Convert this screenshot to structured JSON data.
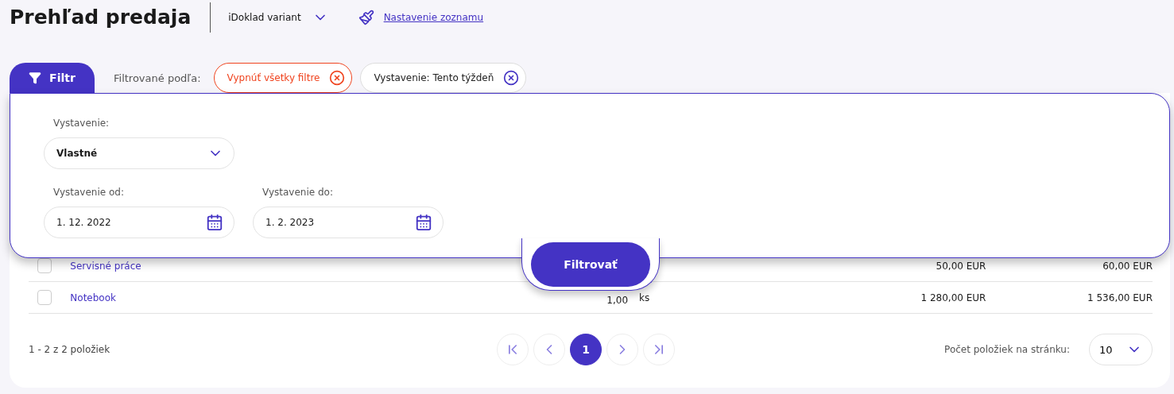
{
  "header": {
    "title": "Prehľad predaja",
    "variant": "iDoklad variant",
    "settings_link": "Nastavenie zoznamu"
  },
  "filter_bar": {
    "tab": "Filtr",
    "label": "Filtrované podľa:",
    "chips": [
      {
        "kind": "clear_all",
        "label": "Vypnúť všetky filtre"
      },
      {
        "kind": "filter",
        "label": "Vystavenie: Tento týždeň"
      }
    ]
  },
  "filter_panel": {
    "issued": {
      "label": "Vystavenie:",
      "value": "Vlastné"
    },
    "from": {
      "label": "Vystavenie od:",
      "value": "1. 12. 2022"
    },
    "to": {
      "label": "Vystavenie do:",
      "value": "1. 2. 2023"
    },
    "button": "Filtrovať"
  },
  "table": {
    "rows": [
      {
        "checked": false,
        "name": "Servisné práce",
        "price": "50,00 EUR",
        "total": "60,00 EUR"
      },
      {
        "checked": false,
        "name": "Notebook",
        "quantity": "1,00",
        "unit": "ks",
        "price": "1 280,00 EUR",
        "total": "1 536,00 EUR"
      }
    ]
  },
  "pagination": {
    "summary": "1 - 2 z 2 položiek",
    "pages": [
      {
        "label": "1",
        "selected": true
      }
    ],
    "per_page_label": "Počet položiek na stránku:",
    "per_page": "10"
  }
}
